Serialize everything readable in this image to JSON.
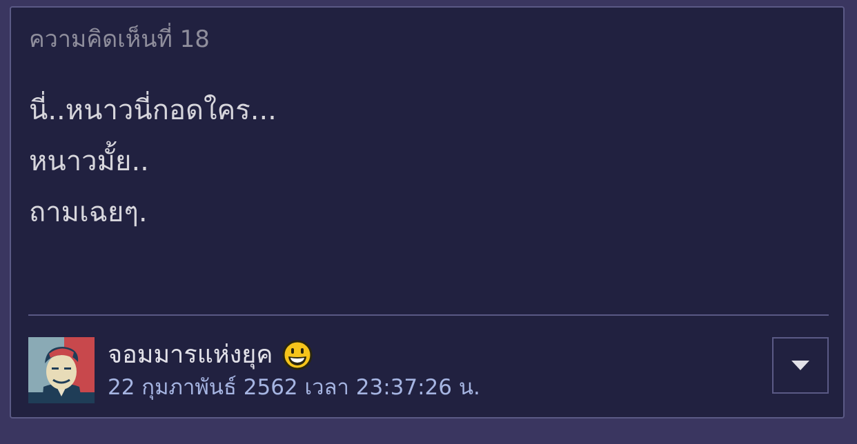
{
  "comment": {
    "number_label": "ความคิดเห็นที่ 18",
    "lines": [
      "นี่..หนาวนี่กอดใคร...",
      "หนาวมั้ย..",
      "ถามเฉยๆ."
    ]
  },
  "author": {
    "name": "จอมมารแห่งยุค",
    "avatar": "portrait-poster-avatar",
    "emoticon": "grinning-face-icon"
  },
  "meta": {
    "posted_at": "22 กุมภาพันธ์ 2562 เวลา 23:37:26 น."
  },
  "actions": {
    "menu_icon": "chevron-down-icon"
  },
  "colors": {
    "page_background": "#3a3660",
    "card_background": "#212140",
    "card_border": "#5b5a86",
    "comment_number": "#8f8e9c",
    "comment_text": "#d7d6dc",
    "author_name": "#e2e1e8",
    "timestamp": "#a6b5e2"
  }
}
